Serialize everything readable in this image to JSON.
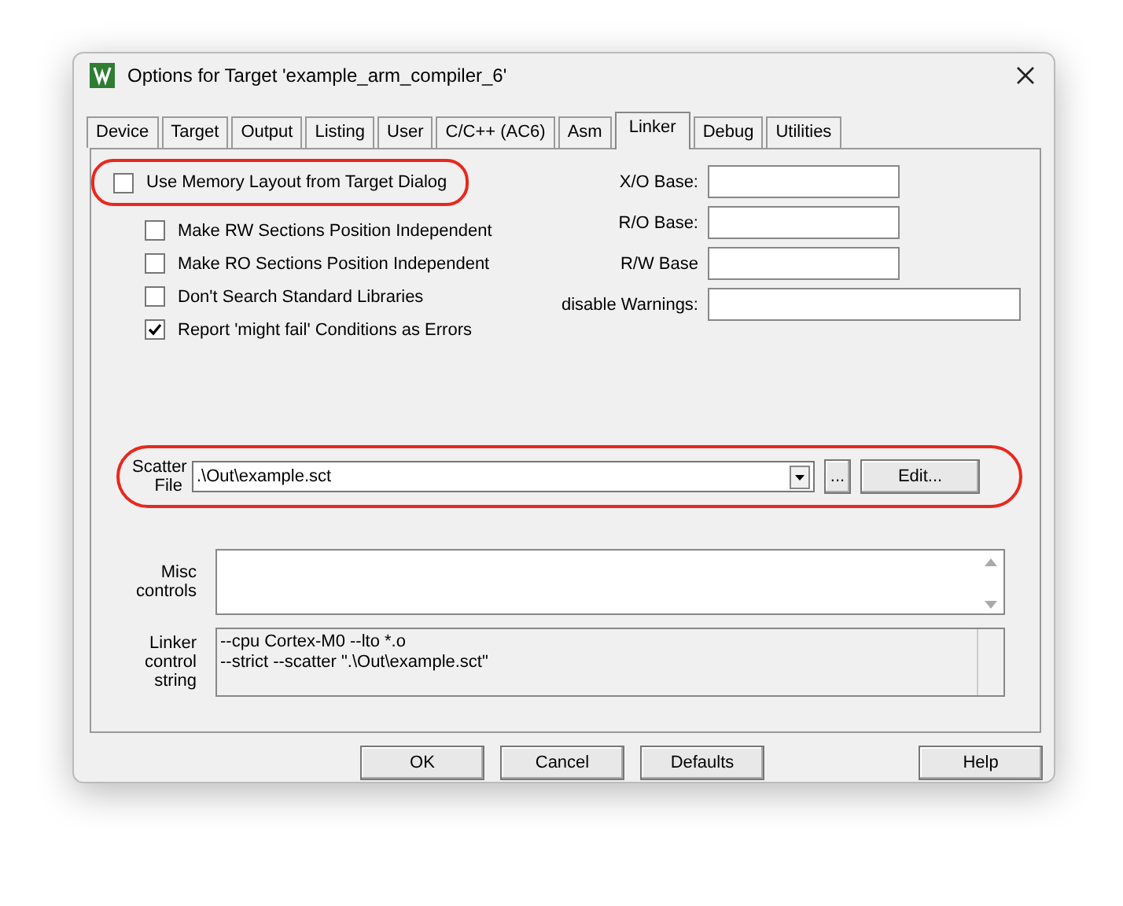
{
  "window": {
    "title": "Options for Target 'example_arm_compiler_6'"
  },
  "tabs": [
    {
      "label": "Device",
      "selected": false
    },
    {
      "label": "Target",
      "selected": false
    },
    {
      "label": "Output",
      "selected": false
    },
    {
      "label": "Listing",
      "selected": false
    },
    {
      "label": "User",
      "selected": false
    },
    {
      "label": "C/C++ (AC6)",
      "selected": false
    },
    {
      "label": "Asm",
      "selected": false
    },
    {
      "label": "Linker",
      "selected": true
    },
    {
      "label": "Debug",
      "selected": false
    },
    {
      "label": "Utilities",
      "selected": false
    }
  ],
  "memory_layout_option": {
    "label": "Use Memory Layout from Target Dialog",
    "checked": false,
    "highlighted": true
  },
  "options": [
    {
      "label": "Make RW Sections Position Independent",
      "checked": false
    },
    {
      "label": "Make RO Sections Position Independent",
      "checked": false
    },
    {
      "label": "Don't Search Standard Libraries",
      "checked": false
    },
    {
      "label": "Report 'might fail' Conditions as Errors",
      "checked": true
    }
  ],
  "bases": [
    {
      "label": "X/O Base:"
    },
    {
      "label": "R/O Base:"
    },
    {
      "label": "R/W Base"
    }
  ],
  "disable_warnings": {
    "label": "disable Warnings:"
  },
  "scatter_file": {
    "label": [
      "Scatter",
      "File"
    ],
    "value": ".\\Out\\example.sct",
    "browse": "...",
    "edit": "Edit...",
    "highlighted": true
  },
  "misc_controls": {
    "label": [
      "Misc",
      "controls"
    ]
  },
  "linker_control_string": {
    "label": [
      "Linker",
      "control",
      "string"
    ],
    "lines": [
      "--cpu Cortex-M0 --lto *.o",
      "--strict --scatter \".\\Out\\example.sct\""
    ]
  },
  "buttons": [
    {
      "label": "OK",
      "kind": "main"
    },
    {
      "label": "Cancel",
      "kind": "main"
    },
    {
      "label": "Defaults",
      "kind": "main"
    },
    {
      "label": "Help",
      "kind": "side"
    }
  ]
}
